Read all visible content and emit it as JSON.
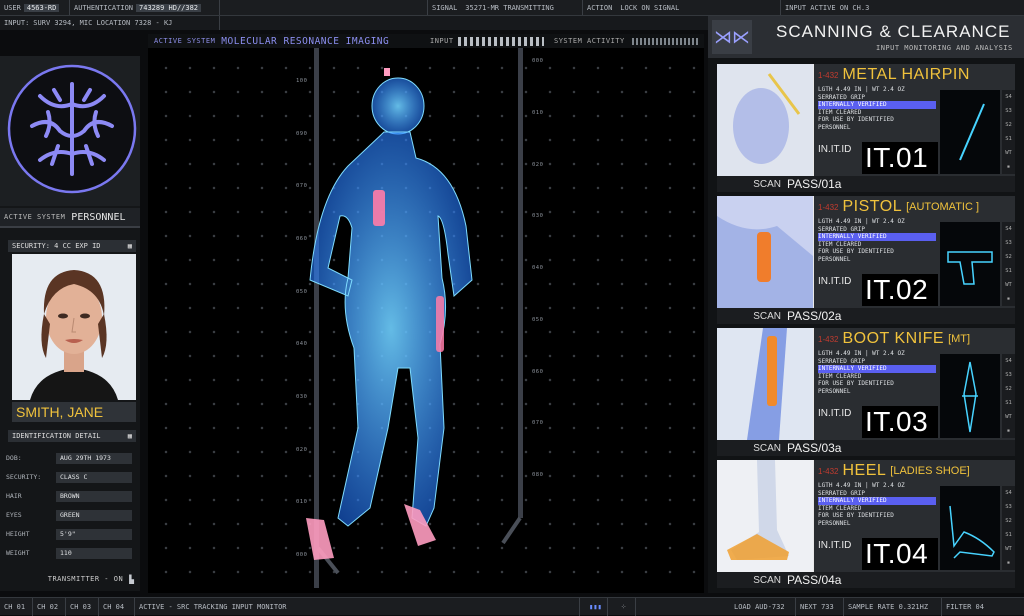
{
  "topbar": {
    "user_label": "User",
    "user_value": "4563-RD",
    "auth_label": "Authentication",
    "auth_value": "743289 HD//382",
    "signal_label": "Signal",
    "signal_value": "35271-MR Transmitting",
    "action_label": "Action",
    "action_value": "Lock on Signal",
    "input_status": "Input Active on CH.3"
  },
  "secbar": {
    "input_label": "Input:",
    "input_value": "SURV 3294, MIC Location 7328 - KJ"
  },
  "center_header": {
    "active_system_label": "Active System",
    "active_system_value": "Molecular Resonance Imaging",
    "input_label": "Input",
    "system_activity_label": "System Activity"
  },
  "scale_labels": [
    "100",
    "090",
    "070",
    "060",
    "050",
    "040",
    "030",
    "020",
    "010",
    "000"
  ],
  "scale_labels_right": [
    "000",
    "010",
    "020",
    "030",
    "040",
    "050",
    "060",
    "070",
    "080"
  ],
  "left": {
    "active_system_label": "Active System",
    "active_system_value": "Personnel",
    "security_header": "Security: 4 CC Exp ID",
    "name": "Smith, Jane",
    "id_detail_header": "Identification Detail",
    "fields": [
      {
        "label": "DOB:",
        "value": "Aug 29th 1973"
      },
      {
        "label": "Security:",
        "value": "Class C"
      },
      {
        "label": "Hair",
        "value": "Brown"
      },
      {
        "label": "Eyes",
        "value": "Green"
      },
      {
        "label": "Height",
        "value": "5'9\""
      },
      {
        "label": "Weight",
        "value": "110"
      }
    ],
    "transmitter": "Transmitter - On"
  },
  "right": {
    "title": "Scanning & Clearance",
    "subtitle": "Input Monitoring and Analysis",
    "items": [
      {
        "code": "1-432",
        "name": "Metal Hairpin",
        "sub": "",
        "id_label": "IN.IT.ID",
        "id": "IT.01",
        "scan_label": "SCAN",
        "pass": "PASS/01a",
        "icon": "hairpin-icon"
      },
      {
        "code": "1-432",
        "name": "Pistol",
        "sub": "[Automatic ]",
        "id_label": "IN.IT.ID",
        "id": "IT.02",
        "scan_label": "SCAN",
        "pass": "PASS/02a",
        "icon": "pistol-icon"
      },
      {
        "code": "1-432",
        "name": "Boot Knife",
        "sub": "[MT]",
        "id_label": "IN.IT.ID",
        "id": "IT.03",
        "scan_label": "SCAN",
        "pass": "PASS/03a",
        "icon": "knife-icon"
      },
      {
        "code": "1-432",
        "name": "Heel",
        "sub": "[Ladies Shoe]",
        "id_label": "IN.IT.ID",
        "id": "IT.04",
        "scan_label": "SCAN",
        "pass": "PASS/04a",
        "icon": "shoe-icon"
      }
    ],
    "detail_lines": [
      "LGTH 4.49 in | WT 2.4 oz",
      "Serrated Grip",
      "Internally Verified",
      "Item Cleared",
      "For use by identified",
      "Personnel"
    ],
    "side_labels": [
      "S4",
      "S3",
      "S2",
      "S1",
      "WT",
      ""
    ]
  },
  "bottombar": {
    "channels": [
      "CH 01",
      "CH 02",
      "CH 03",
      "CH 04"
    ],
    "active": "Active - SRC Tracking Input Monitor",
    "load": "Load AUD-732",
    "next": "Next 733",
    "sample_rate": "Sample Rate 0.321Hz",
    "filter": "Filter 04"
  },
  "colors": {
    "accent": "#f0c23c",
    "hologram": "#2fa8ff",
    "purple": "#6a67e8",
    "alert": "#ff6fa0"
  }
}
